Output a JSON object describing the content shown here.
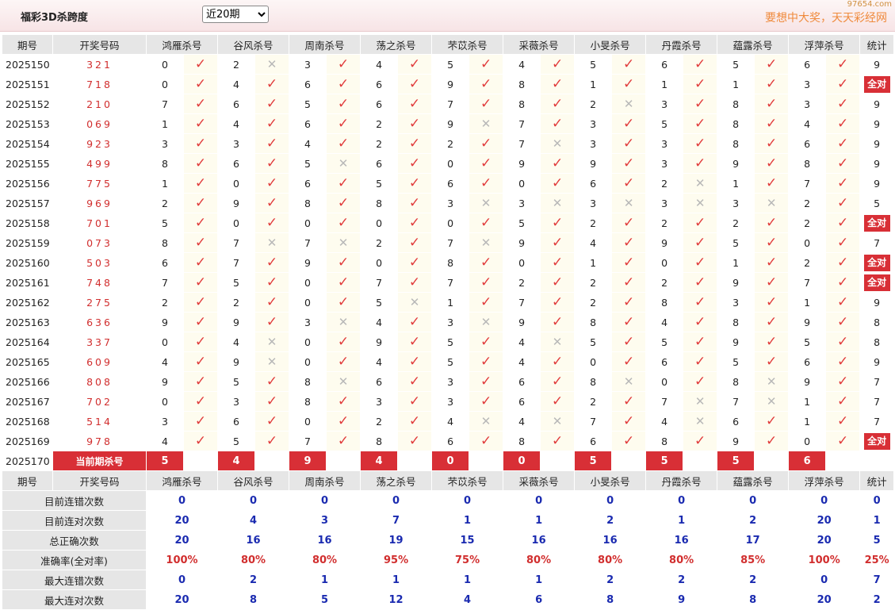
{
  "header": {
    "title": "福彩3D杀跨度",
    "period_select": "近20期",
    "slogan": "要想中大奖，天天彩经网",
    "site": "97654.com"
  },
  "columns": {
    "period": "期号",
    "winning": "开奖号码",
    "experts": [
      "鸿雁杀号",
      "谷风杀号",
      "周南杀号",
      "荡之杀号",
      "芣苡杀号",
      "采薇杀号",
      "小旻杀号",
      "丹霞杀号",
      "蕴露杀号",
      "浮萍杀号"
    ],
    "stat": "统计"
  },
  "rows": [
    {
      "period": "2025150",
      "win": "321",
      "k": [
        0,
        2,
        3,
        4,
        5,
        4,
        5,
        6,
        5,
        6
      ],
      "ok": [
        1,
        0,
        1,
        1,
        1,
        1,
        1,
        1,
        1,
        1
      ],
      "stat": "9"
    },
    {
      "period": "2025151",
      "win": "718",
      "k": [
        0,
        4,
        6,
        6,
        9,
        8,
        1,
        1,
        1,
        3
      ],
      "ok": [
        1,
        1,
        1,
        1,
        1,
        1,
        1,
        1,
        1,
        1
      ],
      "stat": "全对"
    },
    {
      "period": "2025152",
      "win": "210",
      "k": [
        7,
        6,
        5,
        6,
        7,
        8,
        2,
        3,
        8,
        3
      ],
      "ok": [
        1,
        1,
        1,
        1,
        1,
        1,
        0,
        1,
        1,
        1
      ],
      "stat": "9"
    },
    {
      "period": "2025153",
      "win": "069",
      "k": [
        1,
        4,
        6,
        2,
        9,
        7,
        3,
        5,
        8,
        4
      ],
      "ok": [
        1,
        1,
        1,
        1,
        0,
        1,
        1,
        1,
        1,
        1
      ],
      "stat": "9"
    },
    {
      "period": "2025154",
      "win": "923",
      "k": [
        3,
        3,
        4,
        2,
        2,
        7,
        3,
        3,
        8,
        6
      ],
      "ok": [
        1,
        1,
        1,
        1,
        1,
        0,
        1,
        1,
        1,
        1
      ],
      "stat": "9"
    },
    {
      "period": "2025155",
      "win": "499",
      "k": [
        8,
        6,
        5,
        6,
        0,
        9,
        9,
        3,
        9,
        8
      ],
      "ok": [
        1,
        1,
        0,
        1,
        1,
        1,
        1,
        1,
        1,
        1
      ],
      "stat": "9"
    },
    {
      "period": "2025156",
      "win": "775",
      "k": [
        1,
        0,
        6,
        5,
        6,
        0,
        6,
        2,
        1,
        7
      ],
      "ok": [
        1,
        1,
        1,
        1,
        1,
        1,
        1,
        0,
        1,
        1
      ],
      "stat": "9"
    },
    {
      "period": "2025157",
      "win": "969",
      "k": [
        2,
        9,
        8,
        8,
        3,
        3,
        3,
        3,
        3,
        2
      ],
      "ok": [
        1,
        1,
        1,
        1,
        0,
        0,
        0,
        0,
        0,
        1
      ],
      "stat": "5"
    },
    {
      "period": "2025158",
      "win": "701",
      "k": [
        5,
        0,
        0,
        0,
        0,
        5,
        2,
        2,
        2,
        2
      ],
      "ok": [
        1,
        1,
        1,
        1,
        1,
        1,
        1,
        1,
        1,
        1
      ],
      "stat": "全对"
    },
    {
      "period": "2025159",
      "win": "073",
      "k": [
        8,
        7,
        7,
        2,
        7,
        9,
        4,
        9,
        5,
        0
      ],
      "ok": [
        1,
        0,
        0,
        1,
        0,
        1,
        1,
        1,
        1,
        1
      ],
      "stat": "7"
    },
    {
      "period": "2025160",
      "win": "503",
      "k": [
        6,
        7,
        9,
        0,
        8,
        0,
        1,
        0,
        1,
        2
      ],
      "ok": [
        1,
        1,
        1,
        1,
        1,
        1,
        1,
        1,
        1,
        1
      ],
      "stat": "全对"
    },
    {
      "period": "2025161",
      "win": "748",
      "k": [
        7,
        5,
        0,
        7,
        7,
        2,
        2,
        2,
        9,
        7
      ],
      "ok": [
        1,
        1,
        1,
        1,
        1,
        1,
        1,
        1,
        1,
        1
      ],
      "stat": "全对"
    },
    {
      "period": "2025162",
      "win": "275",
      "k": [
        2,
        2,
        0,
        5,
        1,
        7,
        2,
        8,
        3,
        1
      ],
      "ok": [
        1,
        1,
        1,
        0,
        1,
        1,
        1,
        1,
        1,
        1
      ],
      "stat": "9"
    },
    {
      "period": "2025163",
      "win": "636",
      "k": [
        9,
        9,
        3,
        4,
        3,
        9,
        8,
        4,
        8,
        9
      ],
      "ok": [
        1,
        1,
        0,
        1,
        0,
        1,
        1,
        1,
        1,
        1
      ],
      "stat": "8"
    },
    {
      "period": "2025164",
      "win": "337",
      "k": [
        0,
        4,
        0,
        9,
        5,
        4,
        5,
        5,
        9,
        5
      ],
      "ok": [
        1,
        0,
        1,
        1,
        1,
        0,
        1,
        1,
        1,
        1
      ],
      "stat": "8"
    },
    {
      "period": "2025165",
      "win": "609",
      "k": [
        4,
        9,
        0,
        4,
        5,
        4,
        0,
        6,
        5,
        6
      ],
      "ok": [
        1,
        0,
        1,
        1,
        1,
        1,
        1,
        1,
        1,
        1
      ],
      "stat": "9"
    },
    {
      "period": "2025166",
      "win": "808",
      "k": [
        9,
        5,
        8,
        6,
        3,
        6,
        8,
        0,
        8,
        9
      ],
      "ok": [
        1,
        1,
        0,
        1,
        1,
        1,
        0,
        1,
        0,
        1
      ],
      "stat": "7"
    },
    {
      "period": "2025167",
      "win": "702",
      "k": [
        0,
        3,
        8,
        3,
        3,
        6,
        2,
        7,
        7,
        1
      ],
      "ok": [
        1,
        1,
        1,
        1,
        1,
        1,
        1,
        0,
        0,
        1
      ],
      "stat": "7"
    },
    {
      "period": "2025168",
      "win": "514",
      "k": [
        3,
        6,
        0,
        2,
        4,
        4,
        7,
        4,
        6,
        1
      ],
      "ok": [
        1,
        1,
        1,
        1,
        0,
        0,
        1,
        0,
        1,
        1
      ],
      "stat": "7"
    },
    {
      "period": "2025169",
      "win": "978",
      "k": [
        4,
        5,
        7,
        8,
        6,
        8,
        6,
        8,
        9,
        0
      ],
      "ok": [
        1,
        1,
        1,
        1,
        1,
        1,
        1,
        1,
        1,
        1
      ],
      "stat": "全对"
    }
  ],
  "current": {
    "period": "2025170",
    "label": "当前期杀号",
    "kills": [
      "5",
      "4",
      "9",
      "4",
      "0",
      "0",
      "5",
      "5",
      "5",
      "6"
    ]
  },
  "stats": [
    {
      "label": "目前连错次数",
      "values": [
        "0",
        "0",
        "0",
        "0",
        "0",
        "0",
        "0",
        "0",
        "0",
        "0",
        "0"
      ]
    },
    {
      "label": "目前连对次数",
      "values": [
        "20",
        "4",
        "3",
        "7",
        "1",
        "1",
        "2",
        "1",
        "2",
        "20",
        "1"
      ]
    },
    {
      "label": "总正确次数",
      "values": [
        "20",
        "16",
        "16",
        "19",
        "15",
        "16",
        "16",
        "16",
        "17",
        "20",
        "5"
      ]
    },
    {
      "label": "准确率(全对率)",
      "values": [
        "100%",
        "80%",
        "80%",
        "95%",
        "75%",
        "80%",
        "80%",
        "80%",
        "85%",
        "100%",
        "25%"
      ],
      "pct": true
    },
    {
      "label": "最大连错次数",
      "values": [
        "0",
        "2",
        "1",
        "1",
        "1",
        "1",
        "2",
        "2",
        "2",
        "0",
        "7"
      ]
    },
    {
      "label": "最大连对次数",
      "values": [
        "20",
        "8",
        "5",
        "12",
        "4",
        "6",
        "8",
        "9",
        "8",
        "20",
        "2"
      ]
    }
  ],
  "marks": {
    "correct": "✓",
    "wrong": "✕"
  },
  "colors": {
    "accent_red": "#d82f36",
    "check_red": "#e13c3c",
    "stat_blue": "#1a2ab0",
    "slogan_orange": "#ef8a3c"
  }
}
